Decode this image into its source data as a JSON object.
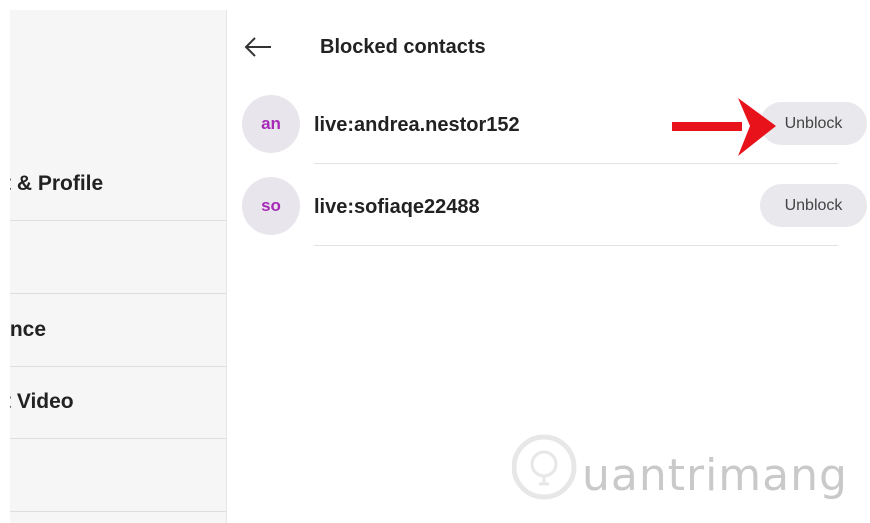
{
  "sidebar": {
    "items": [
      {
        "label": "Account & Profile",
        "visible": "t & Profile"
      },
      {
        "label": "",
        "visible": ""
      },
      {
        "label": "Appearance",
        "visible": "ınce"
      },
      {
        "label": "Audio & Video",
        "visible": "t Video"
      },
      {
        "label": "",
        "visible": ""
      }
    ]
  },
  "header": {
    "title": "Blocked contacts",
    "back_icon": "back-arrow-icon"
  },
  "contacts": [
    {
      "initials": "an",
      "name": "live:andrea.nestor152",
      "action": "Unblock"
    },
    {
      "initials": "so",
      "name": "live:sofiaqe22488",
      "action": "Unblock"
    }
  ],
  "annotation": {
    "icon": "red-arrow-icon",
    "color": "#e8121b"
  },
  "watermark": {
    "text": "uantrimang",
    "icon": "lightbulb-logo-icon"
  },
  "colors": {
    "avatar_text": "#a629b8",
    "avatar_bg": "#e8e6ec",
    "button_bg": "#e9e8ec"
  }
}
